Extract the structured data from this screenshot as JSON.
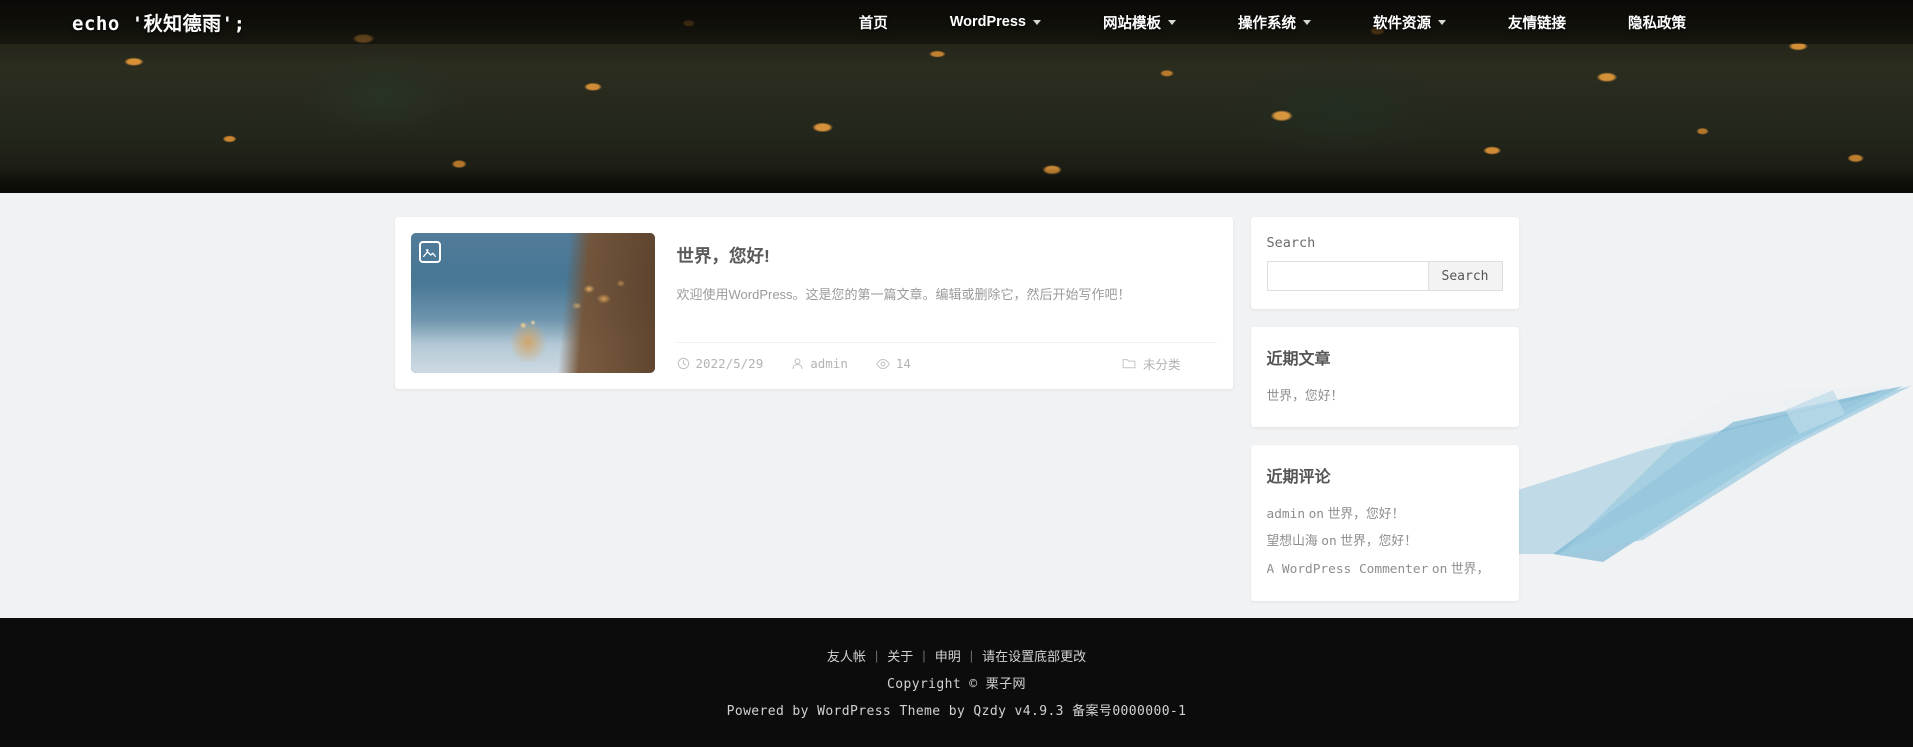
{
  "header": {
    "site_title": "echo '秋知德雨';",
    "nav": [
      {
        "label": "首页",
        "has_dropdown": false
      },
      {
        "label": "WordPress",
        "has_dropdown": true
      },
      {
        "label": "网站模板",
        "has_dropdown": true
      },
      {
        "label": "操作系统",
        "has_dropdown": true
      },
      {
        "label": "软件资源",
        "has_dropdown": true
      },
      {
        "label": "友情链接",
        "has_dropdown": false
      },
      {
        "label": "隐私政策",
        "has_dropdown": false
      }
    ]
  },
  "post": {
    "title": "世界，您好!",
    "excerpt": "欢迎使用WordPress。这是您的第一篇文章。编辑或删除它，然后开始写作吧！",
    "date": "2022/5/29",
    "author": "admin",
    "views": "14",
    "category": "未分类",
    "thumbnail_badge_icon": "image-icon"
  },
  "sidebar": {
    "search": {
      "label": "Search",
      "input_value": "",
      "placeholder": "",
      "button_label": "Search"
    },
    "recent_posts": {
      "title": "近期文章",
      "items": [
        "世界，您好！"
      ]
    },
    "recent_comments": {
      "title": "近期评论",
      "items": [
        {
          "author": "admin",
          "on": "on",
          "post": "世界，您好！"
        },
        {
          "author": "望想山海",
          "on": "on",
          "post": "世界，您好！"
        },
        {
          "author": "A WordPress Commenter",
          "on": "on",
          "post": "世界，"
        }
      ]
    }
  },
  "footer": {
    "links": [
      "友人帐",
      "关于",
      "申明",
      "请在设置底部更改"
    ],
    "separator": "|",
    "copyright": "Copyright © 栗子网",
    "powered": "Powered by WordPress Theme by Qzdy v4.9.3 备案号0000000-1"
  },
  "colors": {
    "page_bg": "#f1f2f4",
    "card_bg": "#ffffff",
    "footer_bg": "#0c0c0c",
    "hero_dark": "#1d1a12",
    "leaf_orange": "#e2963 8",
    "deco_blue": "#8ec4dc"
  }
}
